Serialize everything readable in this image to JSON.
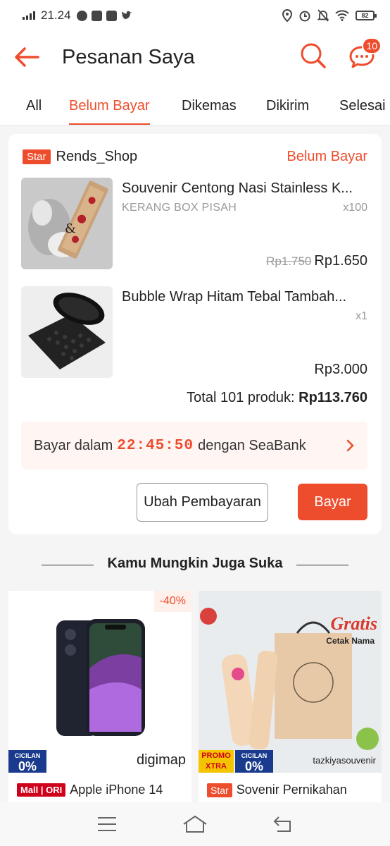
{
  "status_bar": {
    "time": "21.24",
    "battery": "82"
  },
  "header": {
    "title": "Pesanan Saya",
    "chat_badge": "10",
    "accent_color": "#ee4d2d"
  },
  "tabs": [
    {
      "label": "All",
      "active": false
    },
    {
      "label": "Belum Bayar",
      "active": true
    },
    {
      "label": "Dikemas",
      "active": false
    },
    {
      "label": "Dikirim",
      "active": false
    },
    {
      "label": "Selesai",
      "active": false
    }
  ],
  "order": {
    "shop_tag": "Star",
    "shop_name": "Rends_Shop",
    "status": "Belum Bayar",
    "items": [
      {
        "name": "Souvenir Centong Nasi Stainless K...",
        "variant": "KERANG BOX PISAH",
        "qty": "x100",
        "old_price": "Rp1.750",
        "price": "Rp1.650"
      },
      {
        "name": "Bubble Wrap Hitam Tebal Tambah...",
        "variant": "",
        "qty": "x1",
        "old_price": "",
        "price": "Rp3.000"
      }
    ],
    "total_label": "Total 101 produk:",
    "total_value": "Rp113.760",
    "pay_prefix": "Bayar dalam",
    "countdown": "22:45:50",
    "pay_suffix": "dengan SeaBank",
    "change_payment_label": "Ubah Pembayaran",
    "pay_button_label": "Bayar"
  },
  "recommendations": {
    "heading": "Kamu Mungkin Juga Suka",
    "products": [
      {
        "tag": "Mall | ORI",
        "title": "Apple iPhone 14",
        "discount": "-40%",
        "promo_badge": "CICILAN 0%",
        "brand_watermark": "digimap"
      },
      {
        "tag": "Star",
        "title": "Sovenir Pernikahan",
        "discount": "",
        "promo_badge": "PROMO XTRA · CICILAN 0%",
        "brand_watermark": "tazkiyasouvenir",
        "overlay_text": "Gratis",
        "overlay_subtext": "Cetak Nama"
      }
    ]
  }
}
